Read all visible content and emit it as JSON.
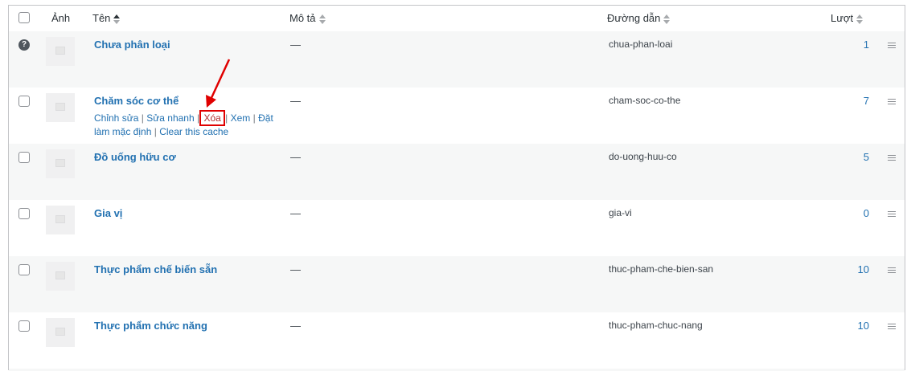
{
  "header": {
    "image_label": "Ảnh",
    "name_label": "Tên",
    "desc_label": "Mô tả",
    "slug_label": "Đường dẫn",
    "count_label": "Lượt"
  },
  "row_actions": {
    "edit": "Chỉnh sửa",
    "quick_edit": "Sửa nhanh",
    "delete": "Xóa",
    "view": "Xem",
    "make_default": "Đặt làm mặc định",
    "clear_cache": "Clear this cache",
    "sep": "|"
  },
  "rows": [
    {
      "name": "Chưa phân loại",
      "desc": "—",
      "slug": "chua-phan-loai",
      "count": "1"
    },
    {
      "name": "Chăm sóc cơ thể",
      "desc": "—",
      "slug": "cham-soc-co-the",
      "count": "7"
    },
    {
      "name": "Đồ uống hữu cơ",
      "desc": "—",
      "slug": "do-uong-huu-co",
      "count": "5"
    },
    {
      "name": "Gia vị",
      "desc": "—",
      "slug": "gia-vi",
      "count": "0"
    },
    {
      "name": "Thực phẩm chế biến sẵn",
      "desc": "—",
      "slug": "thuc-pham-che-bien-san",
      "count": "10"
    },
    {
      "name": "Thực phẩm chức năng",
      "desc": "—",
      "slug": "thuc-pham-chuc-nang",
      "count": "10"
    }
  ],
  "colors": {
    "link": "#2271b1",
    "highlight": "#e00000",
    "delete": "#b32d2e"
  },
  "icons": {
    "help": "question-circle-icon",
    "drag": "drag-handle-icon",
    "placeholder": "image-placeholder-icon"
  }
}
